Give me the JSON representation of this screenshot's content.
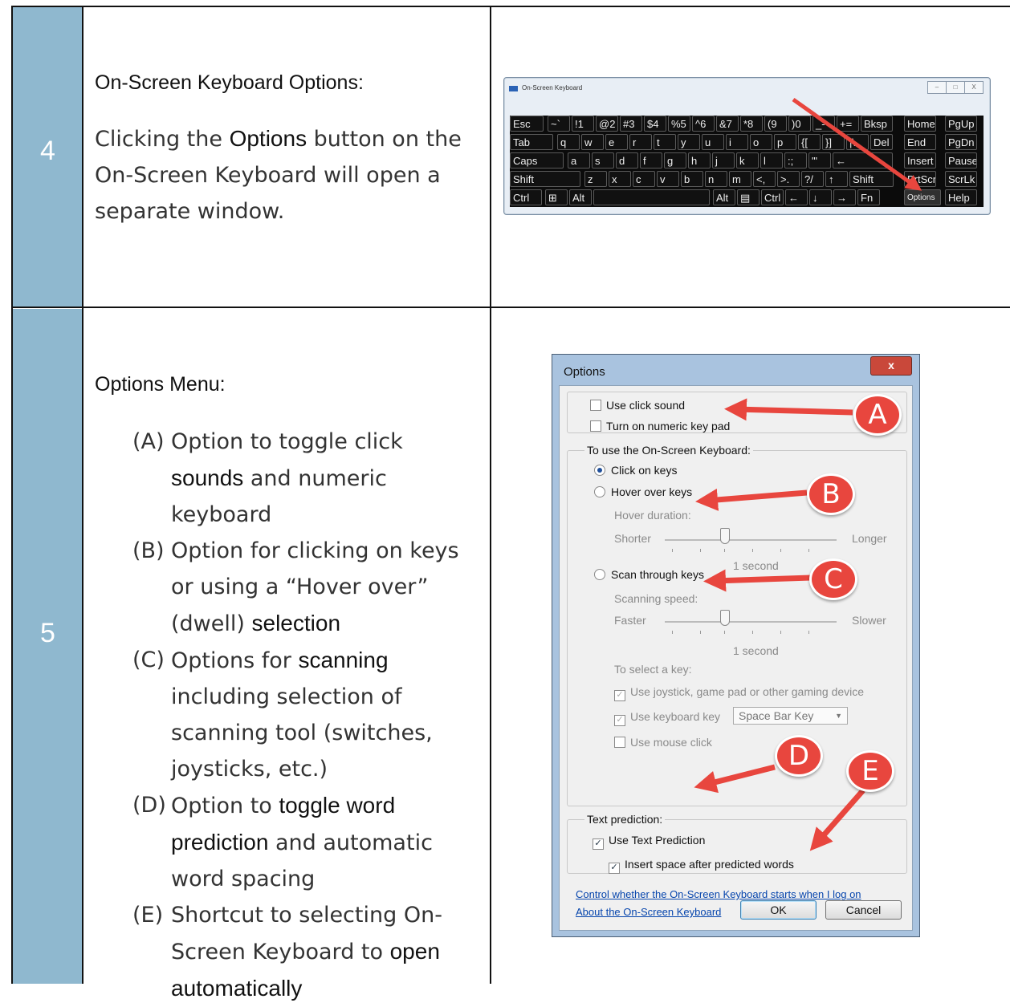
{
  "rows": [
    {
      "number": "4",
      "heading": "On-Screen Keyboard Options:",
      "para": {
        "p1": "Clicking the ",
        "bold": "Options",
        "p2": " button on the On-Screen Keyboard will open a separate window."
      }
    },
    {
      "number": "5",
      "heading": "Options Menu:",
      "items": [
        {
          "marker": "(A)",
          "t1": "Option to toggle click ",
          "b1": "sounds",
          "t2": " and numeric keyboard",
          "b2": "",
          "t3": ""
        },
        {
          "marker": "(B)",
          "t1": "Option for clicking on keys or using a “Hover over” (dwell) ",
          "b1": "selection",
          "t2": "",
          "b2": "",
          "t3": ""
        },
        {
          "marker": "(C)",
          "t1": "Options for ",
          "b1": "scanning",
          "t2": " including selection of scanning tool (switches, joysticks, etc.)",
          "b2": "",
          "t3": ""
        },
        {
          "marker": "(D)",
          "t1": "Option to ",
          "b1": "toggle word prediction",
          "t2": " and automatic word spacing",
          "b2": "",
          "t3": ""
        },
        {
          "marker": "(E)",
          "t1": "Shortcut to selecting On-Screen Keyboard to ",
          "b1": "open automatically",
          "t2": "",
          "b2": "",
          "t3": ""
        }
      ]
    }
  ],
  "keyboard": {
    "title": "On-Screen Keyboard",
    "window_buttons": [
      "–",
      "□",
      "X"
    ],
    "keys": [
      [
        "Esc",
        "~`",
        "!1",
        "@2",
        "#3",
        "$4",
        "%5",
        "^6",
        "&7",
        "*8",
        "(9",
        ")0",
        "_-",
        "+=",
        "Bksp",
        "Home",
        "PgUp"
      ],
      [
        "Tab",
        "q",
        "w",
        "e",
        "r",
        "t",
        "y",
        "u",
        "i",
        "o",
        "p",
        "{[",
        "}]",
        "|\\",
        "Del",
        "End",
        "PgDn"
      ],
      [
        "Caps",
        "a",
        "s",
        "d",
        "f",
        "g",
        "h",
        "j",
        "k",
        "l",
        ":;",
        "\"'",
        "←",
        "Insert",
        "Pause"
      ],
      [
        "Shift",
        "z",
        "x",
        "c",
        "v",
        "b",
        "n",
        "m",
        "<,",
        ">.",
        "?/",
        "↑",
        "Shift",
        "PrtScn",
        "ScrLk"
      ],
      [
        "Ctrl",
        "⊞",
        "Alt",
        "",
        "Alt",
        "▤",
        "Ctrl",
        "←",
        "↓",
        "→",
        "Fn",
        "Options",
        "Help"
      ]
    ]
  },
  "options_dialog": {
    "title": "Options",
    "close": "x",
    "use_click_sound": "Use click sound",
    "numeric_keypad": "Turn on numeric key pad",
    "use_group_label": "To use the On-Screen Keyboard:",
    "click_on_keys": "Click on keys",
    "hover_over_keys": "Hover over keys",
    "hover_duration": "Hover duration:",
    "shorter": "Shorter",
    "longer": "Longer",
    "hover_value": "1 second",
    "scan_through_keys": "Scan through keys",
    "scanning_speed": "Scanning speed:",
    "faster": "Faster",
    "slower": "Slower",
    "scan_value": "1 second",
    "select_key": "To select a key:",
    "use_joystick": "Use joystick, game pad or other gaming device",
    "use_keyboard_key": "Use keyboard key",
    "key_combo": "Space Bar Key",
    "use_mouse_click": "Use mouse click",
    "text_prediction_group": "Text prediction:",
    "use_text_prediction": "Use Text Prediction",
    "insert_space": "Insert space after predicted words",
    "link_control": "Control whether the On-Screen Keyboard starts when I log on",
    "link_about": "About the On-Screen Keyboard",
    "ok": "OK",
    "cancel": "Cancel",
    "checked": "✓",
    "badges": [
      "A",
      "B",
      "C",
      "D",
      "E"
    ]
  },
  "colors": {
    "number_column": "#8fb8cf",
    "annotation_red": "#e8463e"
  }
}
